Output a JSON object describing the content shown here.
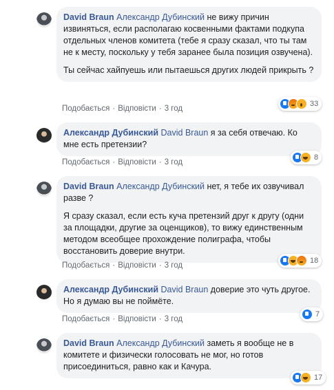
{
  "comments": [
    {
      "author": "David Braun",
      "mention": "Александр Дубинский",
      "text": " не вижу причин извиняться, если располагаю косвенными фактами подкупа отдельных членов комитета (тебе я сразу сказал, что ты там не к месту, поскольку у тебя заранее была позиция озвучена).",
      "text2": "Ты сейчас хайпуешь или пытаешься других людей прикрыть ?",
      "like": "Подобається",
      "reply": "Відповісти",
      "time": "3 год",
      "reaction_count": "33",
      "reaction_icons": [
        "like-icon",
        "angry-icon",
        "wow-icon"
      ]
    },
    {
      "author": "Александр Дубинский",
      "mention": "David Braun",
      "text": " я за себя отвечаю. Ко мне есть претензии?",
      "like": "Подобається",
      "reply": "Відповісти",
      "time": "3 год",
      "reaction_count": "8",
      "reaction_icons": [
        "like-icon",
        "haha-icon"
      ]
    },
    {
      "author": "David Braun",
      "mention": "Александр Дубинский",
      "text": " нет, я тебе их озвучивал разве ?",
      "text2": "Я сразу сказал, если есть куча претензий друг к другу (одни за площадки, другие за оценщиков), то вижу единственным методом всеобщее прохождение полиграфа, чтобы восстановить доверие внутри.",
      "like": "Подобається",
      "reply": "Відповісти",
      "time": "3 год",
      "reaction_count": "18",
      "reaction_icons": [
        "like-icon",
        "haha-icon",
        "angry-icon"
      ]
    },
    {
      "author": "Александр Дубинский",
      "mention": "David Braun",
      "text": " доверие это чуть другое. Но я думаю вы не поймёте.",
      "like": "Подобається",
      "reply": "Відповісти",
      "time": "3 год",
      "reaction_count": "7",
      "reaction_icons": [
        "like-icon"
      ]
    },
    {
      "author": "David Braun",
      "mention": "Александр Дубинский",
      "text": " заметь я вообще не в комитете и физически голосовать не мог, но готов присоединиться, равно как и Качура.",
      "like": "Подобається",
      "reply": "Відповісти",
      "time": "3 год",
      "reaction_count": "17",
      "reaction_icons": [
        "like-icon",
        "haha-icon"
      ]
    }
  ],
  "colors": {
    "author": "#385898",
    "bubble": "#f2f3f5",
    "meta": "#606770",
    "like": "#1877f2",
    "haha": "#f7b125",
    "angry": "#e9710f"
  }
}
